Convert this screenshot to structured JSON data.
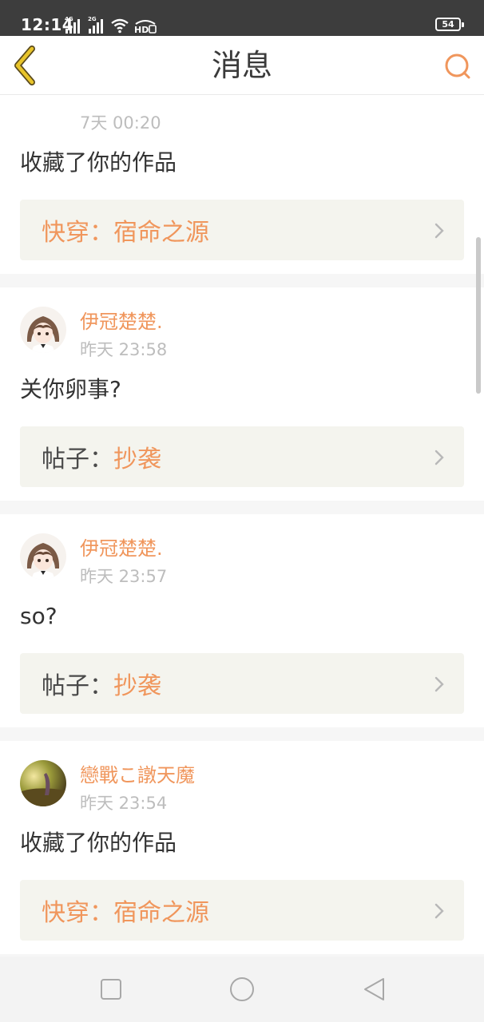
{
  "status_bar": {
    "time": "12:14",
    "network1": "4G",
    "network2": "2G",
    "hd": "HD",
    "battery": "54"
  },
  "header": {
    "title": "消息",
    "back_icon": "chevron-left-icon",
    "search_icon": "search-icon"
  },
  "messages": [
    {
      "partial_timestamp": "7天 00:20",
      "text": "收藏了你的作品",
      "ref_prefix": "快穿：",
      "ref_title": "宿命之源",
      "ref_prefix_accent": true
    },
    {
      "username": "伊冠楚楚.",
      "timestamp": "昨天 23:58",
      "text": "关你卵事?",
      "ref_prefix": "帖子：",
      "ref_title": "抄袭",
      "ref_prefix_accent": false,
      "avatar": "anime-girl"
    },
    {
      "username": "伊冠楚楚.",
      "timestamp": "昨天 23:57",
      "text": "so?",
      "ref_prefix": "帖子：",
      "ref_title": "抄袭",
      "ref_prefix_accent": false,
      "avatar": "anime-girl"
    },
    {
      "username": "戀戰こ譈天魔",
      "timestamp": "昨天 23:54",
      "text": "收藏了你的作品",
      "ref_prefix": "快穿：",
      "ref_title": "宿命之源",
      "ref_prefix_accent": true,
      "avatar": "landscape-photo"
    }
  ],
  "nav": {
    "recent_icon": "square-icon",
    "home_icon": "circle-icon",
    "back_icon": "triangle-back-icon"
  },
  "colors": {
    "accent": "#f0965c",
    "reference_bg": "#f4f4ee",
    "status_bar_bg": "#3d3d3d",
    "back_arrow": "#e8c42a"
  }
}
